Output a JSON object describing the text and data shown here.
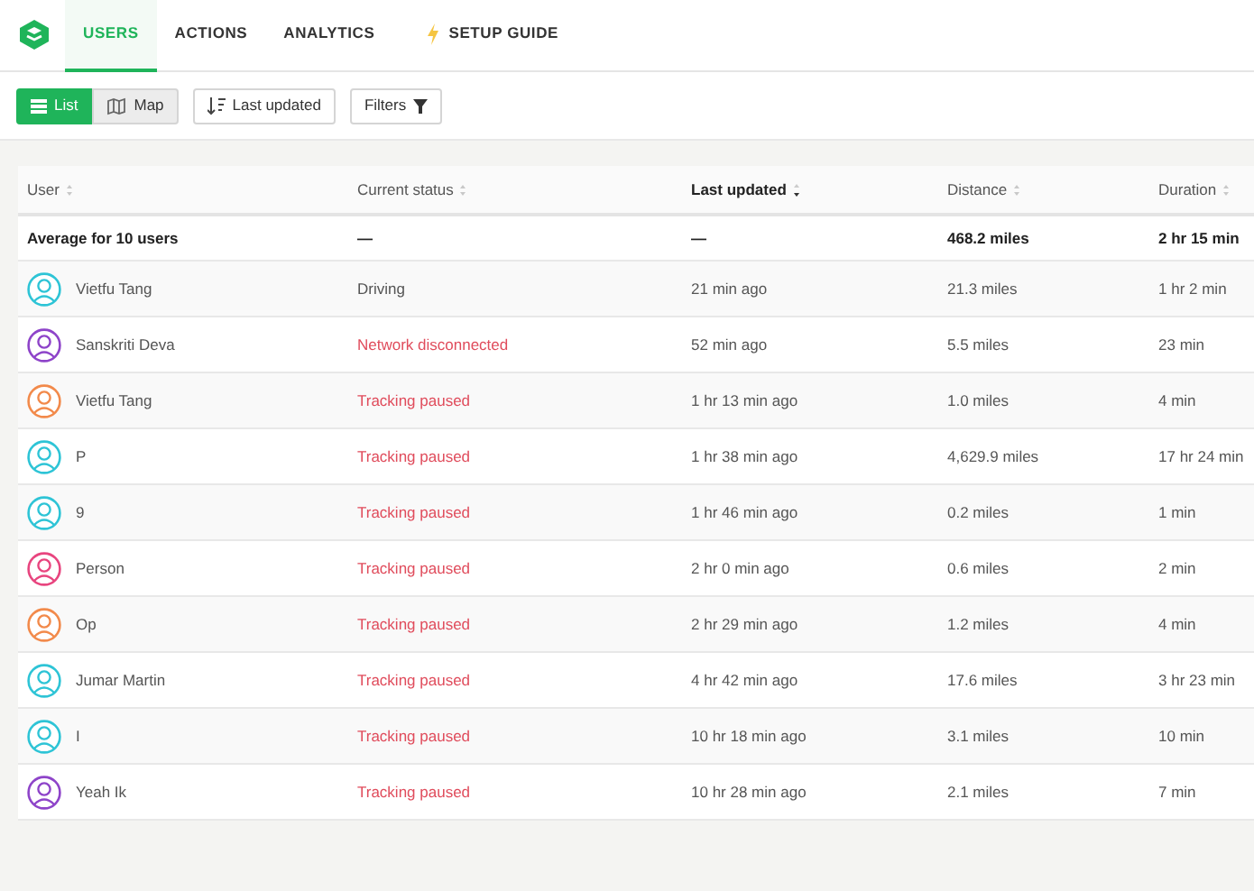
{
  "nav": {
    "tabs": [
      {
        "label": "USERS",
        "selected": true,
        "kind": "plain"
      },
      {
        "label": "ACTIONS",
        "selected": false,
        "kind": "plain"
      },
      {
        "label": "ANALYTICS",
        "selected": false,
        "kind": "plain"
      },
      {
        "label": "SETUP GUIDE",
        "selected": false,
        "kind": "bolt"
      }
    ]
  },
  "toolbar": {
    "views": [
      {
        "label": "List",
        "selected": true,
        "kind": "list"
      },
      {
        "label": "Map",
        "selected": false,
        "kind": "map"
      }
    ],
    "sort_button": "Last updated",
    "filter_button": "Filters"
  },
  "table": {
    "columns": [
      {
        "label": "User",
        "sorted": false
      },
      {
        "label": "Current status",
        "sorted": false
      },
      {
        "label": "Last updated",
        "sorted": true
      },
      {
        "label": "Distance",
        "sorted": false
      },
      {
        "label": "Duration",
        "sorted": false
      }
    ],
    "summary": [
      "Average for 10 users",
      "—",
      "—",
      "468.2 miles",
      "2 hr 15 min"
    ],
    "rows": [
      {
        "user": "Vietfu Tang",
        "color": "#2ec4d6",
        "status": "Driving",
        "kind": "normal",
        "updated": "21 min ago",
        "distance": "21.3 miles",
        "duration": "1 hr 2 min"
      },
      {
        "user": "Sanskriti Deva",
        "color": "#8e44c9",
        "status": "Network disconnected",
        "kind": "alert",
        "updated": "52 min ago",
        "distance": "5.5 miles",
        "duration": "23 min"
      },
      {
        "user": "Vietfu Tang",
        "color": "#f28a4b",
        "status": "Tracking paused",
        "kind": "alert",
        "updated": "1 hr 13 min ago",
        "distance": "1.0 miles",
        "duration": "4 min"
      },
      {
        "user": "P",
        "color": "#2ec4d6",
        "status": "Tracking paused",
        "kind": "alert",
        "updated": "1 hr 38 min ago",
        "distance": "4,629.9 miles",
        "duration": "17 hr 24 min"
      },
      {
        "user": "9",
        "color": "#2ec4d6",
        "status": "Tracking paused",
        "kind": "alert",
        "updated": "1 hr 46 min ago",
        "distance": "0.2 miles",
        "duration": "1 min"
      },
      {
        "user": "Person",
        "color": "#e8457f",
        "status": "Tracking paused",
        "kind": "alert",
        "updated": "2 hr 0 min ago",
        "distance": "0.6 miles",
        "duration": "2 min"
      },
      {
        "user": "Op",
        "color": "#f28a4b",
        "status": "Tracking paused",
        "kind": "alert",
        "updated": "2 hr 29 min ago",
        "distance": "1.2 miles",
        "duration": "4 min"
      },
      {
        "user": "Jumar Martin",
        "color": "#2ec4d6",
        "status": "Tracking paused",
        "kind": "alert",
        "updated": "4 hr 42 min ago",
        "distance": "17.6 miles",
        "duration": "3 hr 23 min"
      },
      {
        "user": "I",
        "color": "#2ec4d6",
        "status": "Tracking paused",
        "kind": "alert",
        "updated": "10 hr 18 min ago",
        "distance": "3.1 miles",
        "duration": "10 min"
      },
      {
        "user": "Yeah Ik",
        "color": "#8e44c9",
        "status": "Tracking paused",
        "kind": "alert",
        "updated": "10 hr 28 min ago",
        "distance": "2.1 miles",
        "duration": "7 min"
      }
    ]
  }
}
